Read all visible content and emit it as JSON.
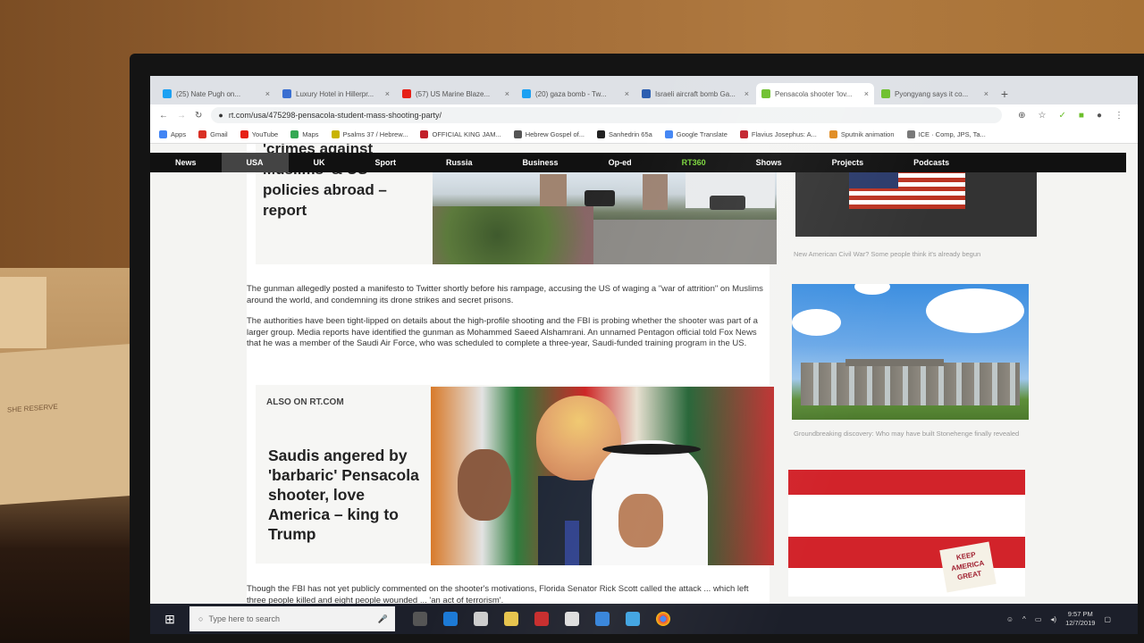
{
  "browser": {
    "tabs": [
      {
        "label": "(25) Nate Pugh on...",
        "color": "#1da1f2"
      },
      {
        "label": "Luxury Hotel in Hillerpr...",
        "color": "#3b6fd1"
      },
      {
        "label": "(57) US Marine Blaze...",
        "color": "#e62117"
      },
      {
        "label": "(20) gaza bomb - Tw...",
        "color": "#1da1f2"
      },
      {
        "label": "Israeli aircraft bomb Ga...",
        "color": "#2a5db0"
      },
      {
        "label": "Pensacola shooter 'lov...",
        "color": "#6cbf2b"
      },
      {
        "label": "Pyongyang says it co...",
        "color": "#6cbf2b"
      }
    ],
    "url": "rt.com/usa/475298-pensacola-student-mass-shooting-party/",
    "bookmarks": [
      {
        "label": "Apps",
        "color": "#4285f4"
      },
      {
        "label": "Gmail",
        "color": "#d93025"
      },
      {
        "label": "YouTube",
        "color": "#e62117"
      },
      {
        "label": "Maps",
        "color": "#34a853"
      },
      {
        "label": "Psalms 37 / Hebrew...",
        "color": "#c9b400"
      },
      {
        "label": "OFFICIAL KING JAM...",
        "color": "#c2202a"
      },
      {
        "label": "Hebrew Gospel of...",
        "color": "#555555"
      },
      {
        "label": "Sanhedrin 65a",
        "color": "#222222"
      },
      {
        "label": "Google Translate",
        "color": "#4285f4"
      },
      {
        "label": "Flavius Josephus: A...",
        "color": "#c2202a"
      },
      {
        "label": "Sputnik animation",
        "color": "#e08a1e"
      },
      {
        "label": "ICE · Comp, JPS, Ta...",
        "color": "#777777"
      }
    ]
  },
  "nav": {
    "items": [
      "News",
      "USA",
      "UK",
      "Sport",
      "Russia",
      "Business",
      "Op-ed",
      "RT360",
      "Shows",
      "Projects",
      "Podcasts"
    ],
    "active": "USA",
    "highlight": "RT360"
  },
  "article": {
    "promo1_title": "'crimes against Muslims' & US policies abroad – report",
    "para1": "The gunman allegedly posted a manifesto to Twitter shortly before his rampage, accusing the US of waging a \"war of attrition\" on Muslims around the world, and condemning its drone strikes and secret prisons.",
    "para2": "The authorities have been tight-lipped on details about the high-profile shooting and the FBI is probing whether the shooter was part of a larger group. Media reports have identified the gunman as Mohammed Saeed Alshamrani. An unnamed Pentagon official told Fox News that he was a member of the Saudi Air Force, who was scheduled to complete a three-year, Saudi-funded training program in the US.",
    "also_on": "ALSO ON RT.COM",
    "promo2_title": "Saudis angered by 'barbaric' Pensacola shooter, love America – king to Trump",
    "para3": "Though the FBI has not yet publicly commented on the shooter's motivations, Florida Senator Rick Scott called the attack ... which left three people killed and eight people wounded ... 'an act of terrorism'."
  },
  "sidebar": {
    "caption1": "New American Civil War? Some people think it's already begun",
    "caption2": "Groundbreaking discovery: Who may have built Stonehenge finally revealed",
    "sign_text": "KEEP AMERICA GREAT"
  },
  "taskbar": {
    "search_placeholder": "Type here to search",
    "time": "9:57 PM",
    "date": "12/7/2019"
  },
  "room": {
    "card_text": "SHE RESERVE"
  }
}
